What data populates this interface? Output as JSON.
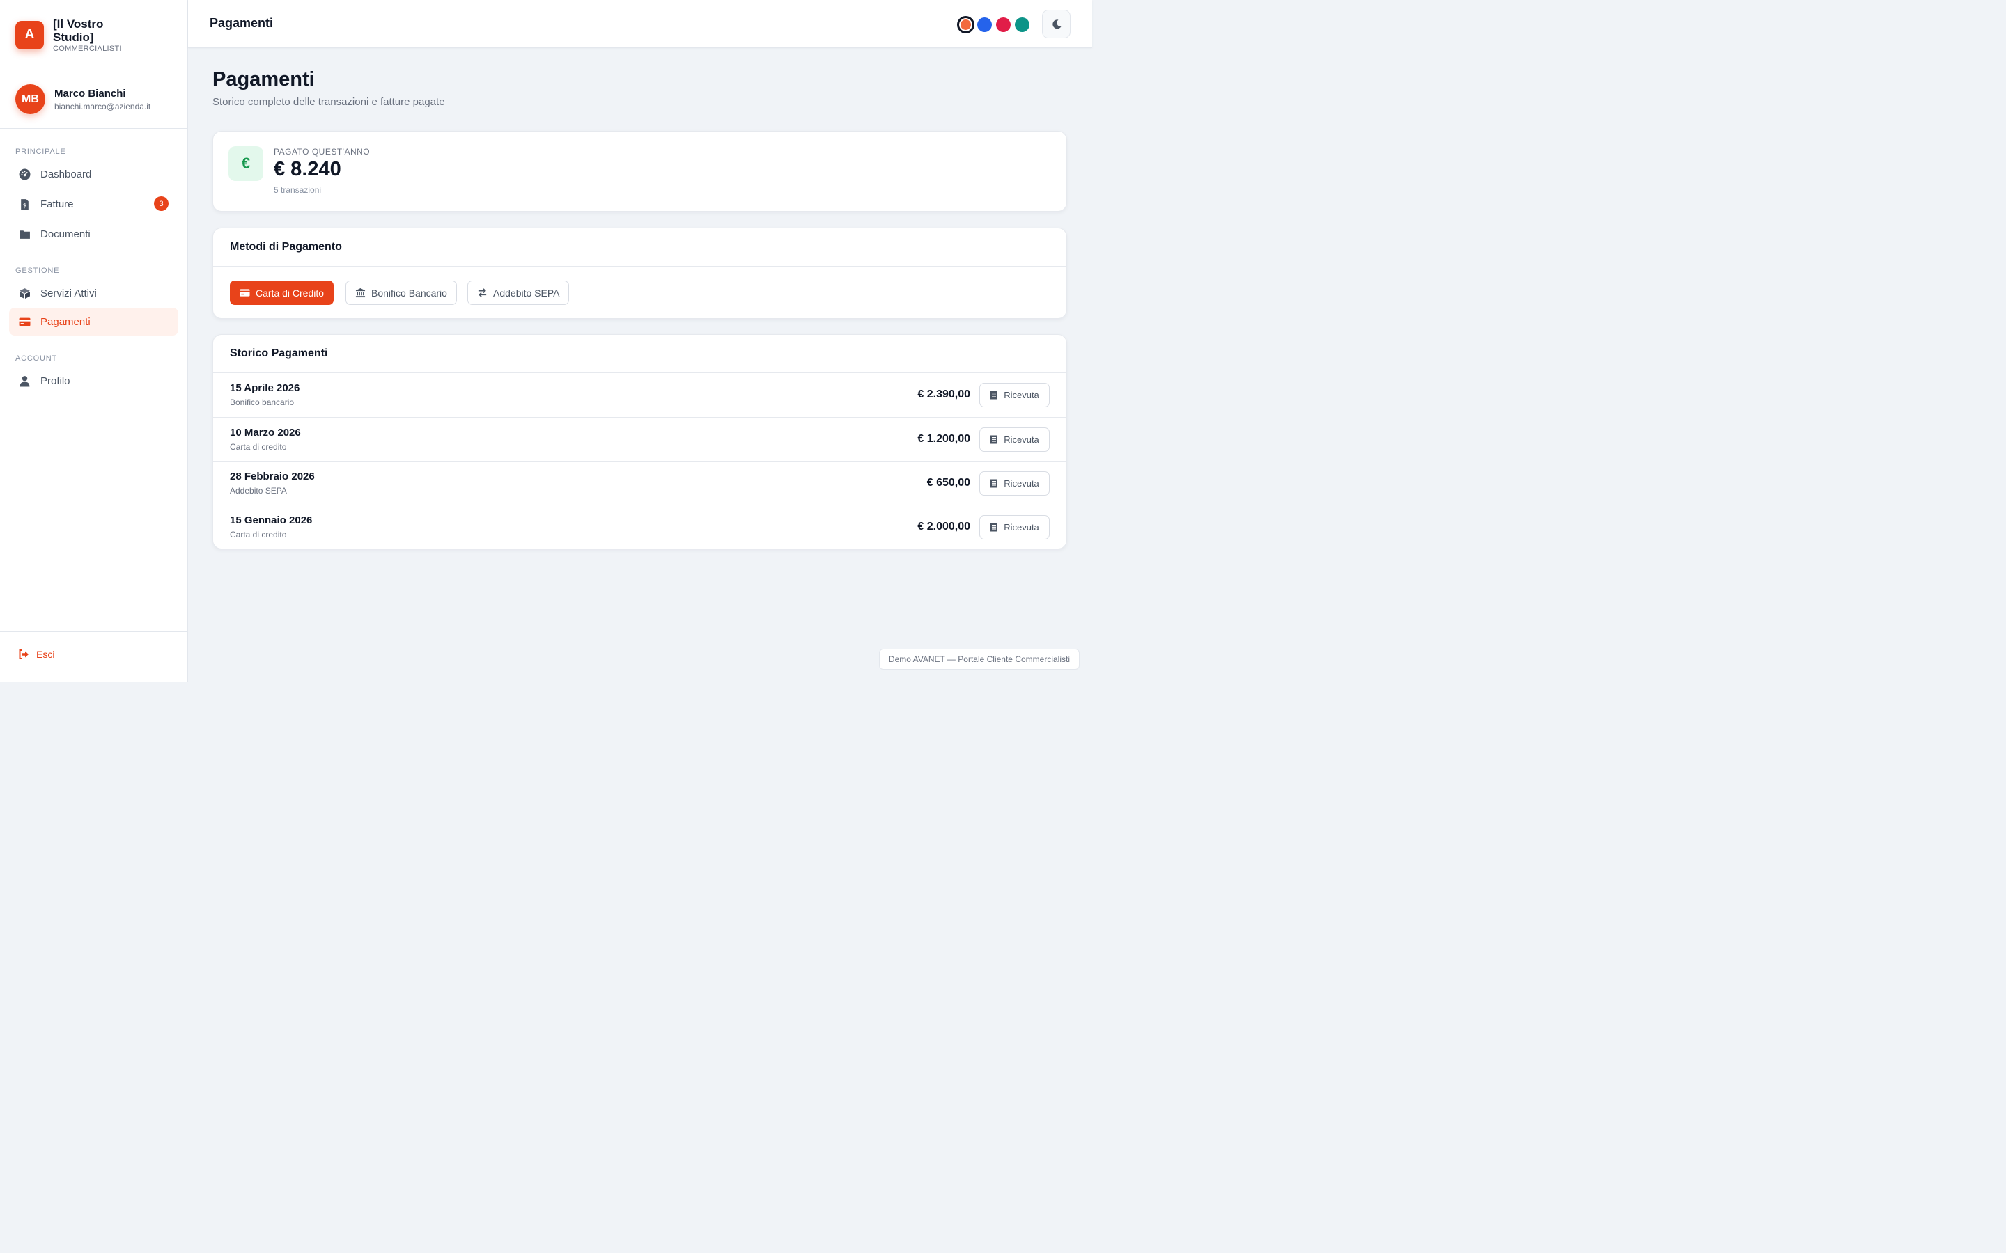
{
  "brand": {
    "logo_letter": "A",
    "name": "[Il Vostro Studio]",
    "subtitle": "COMMERCIALISTI"
  },
  "user": {
    "initials": "MB",
    "name": "Marco Bianchi",
    "email": "bianchi.marco@azienda.it"
  },
  "sidebar": {
    "sections": {
      "principale": "PRINCIPALE",
      "gestione": "GESTIONE",
      "account": "ACCOUNT"
    },
    "items": [
      {
        "label": "Dashboard",
        "icon": "dashboard-icon"
      },
      {
        "label": "Fatture",
        "icon": "invoice-icon",
        "badge": "3"
      },
      {
        "label": "Documenti",
        "icon": "folder-icon"
      },
      {
        "label": "Servizi Attivi",
        "icon": "box-icon"
      },
      {
        "label": "Pagamenti",
        "icon": "credit-card-icon",
        "active": true
      },
      {
        "label": "Profilo",
        "icon": "user-icon"
      }
    ],
    "logout_label": "Esci"
  },
  "topbar": {
    "title": "Pagamenti",
    "theme_colors": [
      "#f26a3d",
      "#2563eb",
      "#e11d48",
      "#0d9488"
    ],
    "selected_color": "#f26a3d"
  },
  "page": {
    "title": "Pagamenti",
    "subtitle": "Storico completo delle transazioni e fatture pagate"
  },
  "stat": {
    "icon": "€",
    "label": "PAGATO QUEST'ANNO",
    "value": "€ 8.240",
    "count": "5 transazioni"
  },
  "methods": {
    "title": "Metodi di Pagamento",
    "items": [
      {
        "label": "Carta di Credito",
        "icon": "credit-card-icon",
        "active": true
      },
      {
        "label": "Bonifico Bancario",
        "icon": "bank-icon",
        "active": false
      },
      {
        "label": "Addebito SEPA",
        "icon": "transfer-icon",
        "active": false
      }
    ]
  },
  "history": {
    "title": "Storico Pagamenti",
    "receipt_label": "Ricevuta",
    "rows": [
      {
        "date": "15 Aprile 2026",
        "method": "Bonifico bancario",
        "amount": "€ 2.390,00"
      },
      {
        "date": "10 Marzo 2026",
        "method": "Carta di credito",
        "amount": "€ 1.200,00"
      },
      {
        "date": "28 Febbraio 2026",
        "method": "Addebito SEPA",
        "amount": "€ 650,00"
      },
      {
        "date": "15 Gennaio 2026",
        "method": "Carta di credito",
        "amount": "€ 2.000,00"
      }
    ]
  },
  "footer": {
    "note": "Demo AVANET — Portale Cliente Commercialisti"
  },
  "colors": {
    "accent": "#e8431a",
    "accent_soft": "#fff1ec",
    "success": "#17994f",
    "background": "#f0f3f7"
  }
}
